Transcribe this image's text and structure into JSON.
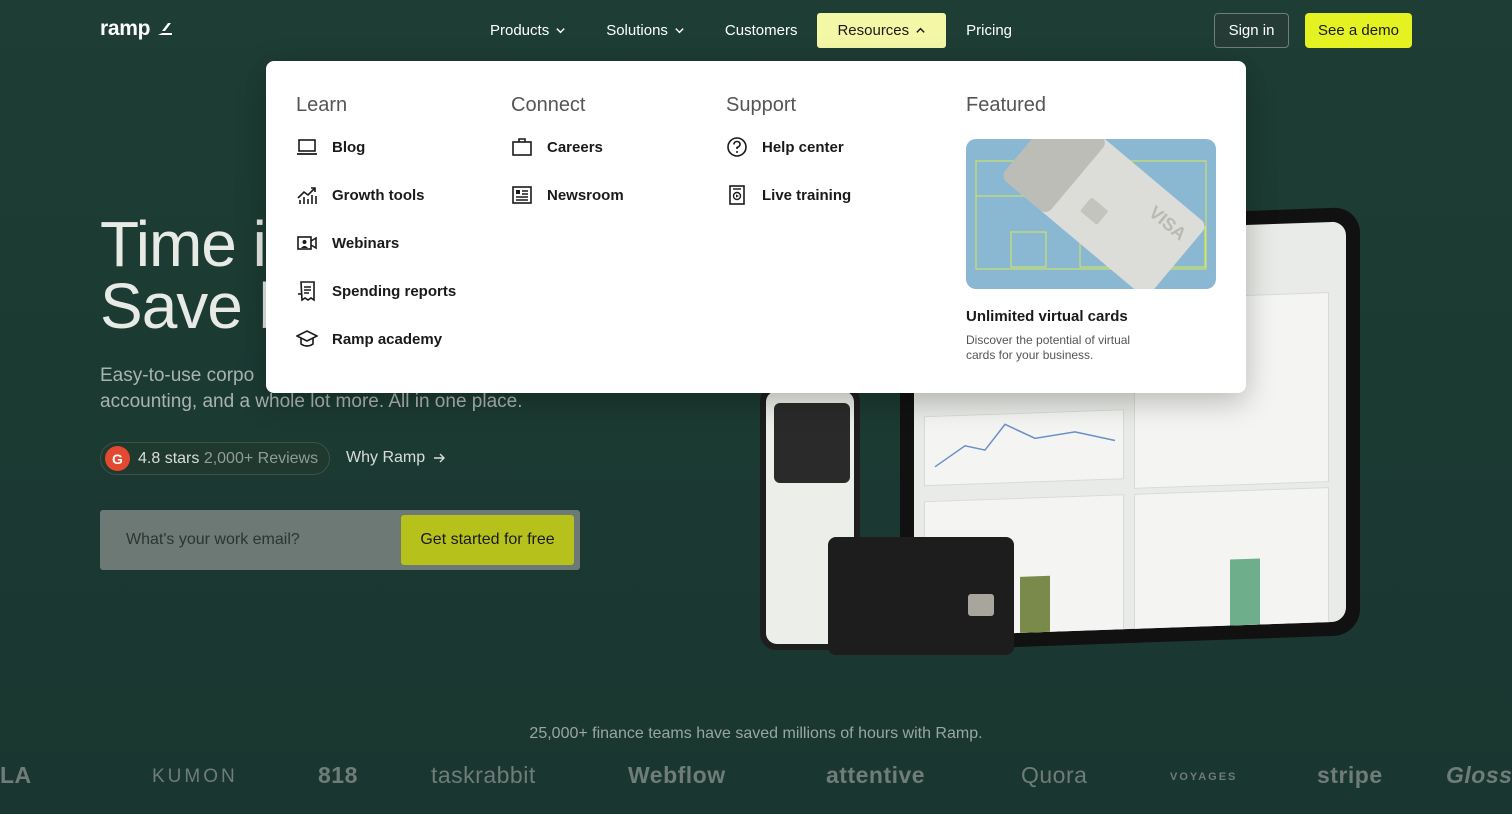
{
  "brand": {
    "name": "ramp"
  },
  "nav": {
    "links": [
      {
        "label": "Products",
        "has_menu": true
      },
      {
        "label": "Solutions",
        "has_menu": true
      },
      {
        "label": "Customers",
        "has_menu": false
      },
      {
        "label": "Resources",
        "has_menu": true,
        "active": true
      },
      {
        "label": "Pricing",
        "has_menu": false
      }
    ],
    "sign_in": "Sign in",
    "see_demo": "See a demo"
  },
  "hero": {
    "title_line1": "Time i",
    "title_line2": "Save b",
    "subtitle_line1": "Easy-to-use corpo",
    "subtitle_line2": "accounting, and a whole lot more. All in one place.",
    "rating_stars": "4.8 stars",
    "rating_reviews": "2,000+ Reviews",
    "rating_badge": "G",
    "why_link": "Why Ramp",
    "email_placeholder": "What's your work email?",
    "cta": "Get started for free"
  },
  "resources_menu": {
    "learn": {
      "title": "Learn",
      "items": [
        {
          "label": "Blog",
          "icon": "laptop-icon"
        },
        {
          "label": "Growth tools",
          "icon": "growth-chart-icon"
        },
        {
          "label": "Webinars",
          "icon": "webinar-icon"
        },
        {
          "label": "Spending reports",
          "icon": "receipt-icon"
        },
        {
          "label": "Ramp academy",
          "icon": "graduation-cap-icon"
        }
      ]
    },
    "connect": {
      "title": "Connect",
      "items": [
        {
          "label": "Careers",
          "icon": "briefcase-icon"
        },
        {
          "label": "Newsroom",
          "icon": "newspaper-icon"
        }
      ]
    },
    "support": {
      "title": "Support",
      "items": [
        {
          "label": "Help center",
          "icon": "question-circle-icon"
        },
        {
          "label": "Live training",
          "icon": "live-training-icon"
        }
      ]
    },
    "featured": {
      "title": "Featured",
      "card_title": "Unlimited virtual cards",
      "card_desc": "Discover the potential of virtual cards for your business.",
      "card_brand": "VISA"
    }
  },
  "trust": {
    "text": "25,000+ finance teams have saved millions of hours with Ramp.",
    "logos": [
      "LA",
      "KUMON",
      "818",
      "taskrabbit",
      "Webflow",
      "attentive",
      "Quora",
      "VOYAGES",
      "stripe",
      "Glossier"
    ]
  },
  "colors": {
    "background": "#1b3a32",
    "accent": "#e4f221",
    "active_nav": "#f4f7a6",
    "cta": "#b6c11c"
  }
}
